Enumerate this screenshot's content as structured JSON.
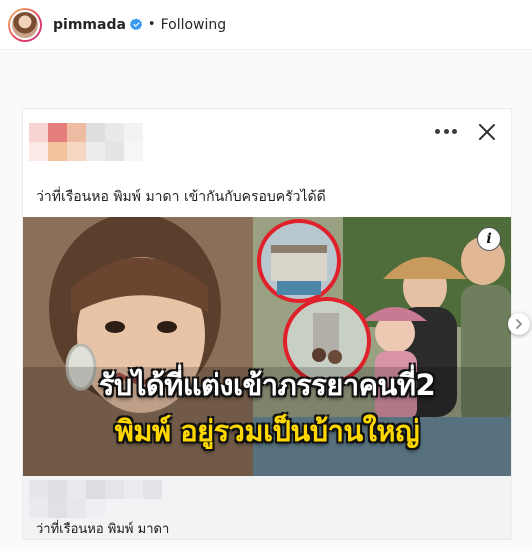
{
  "header": {
    "username": "pimmada",
    "separator": "•",
    "follow_status": "Following"
  },
  "card": {
    "title": "ว่าที่เรือนหอ พิมพ์ มาดา เข้ากันกับครอบครัวได้ดี",
    "headline_line1": "รับได้ที่แต่งเข้าภรรยาคนที่2",
    "headline_line2": "พิมพ์ อยู่รวมเป็นบ้านใหญ่",
    "info_glyph": "i",
    "footer_title": "ว่าที่เรือนหอ พิมพ์ มาดา"
  },
  "colors": {
    "verified": "#3897f0",
    "headline_yellow": "#ffd800",
    "highlight_ring": "#e0202a"
  }
}
